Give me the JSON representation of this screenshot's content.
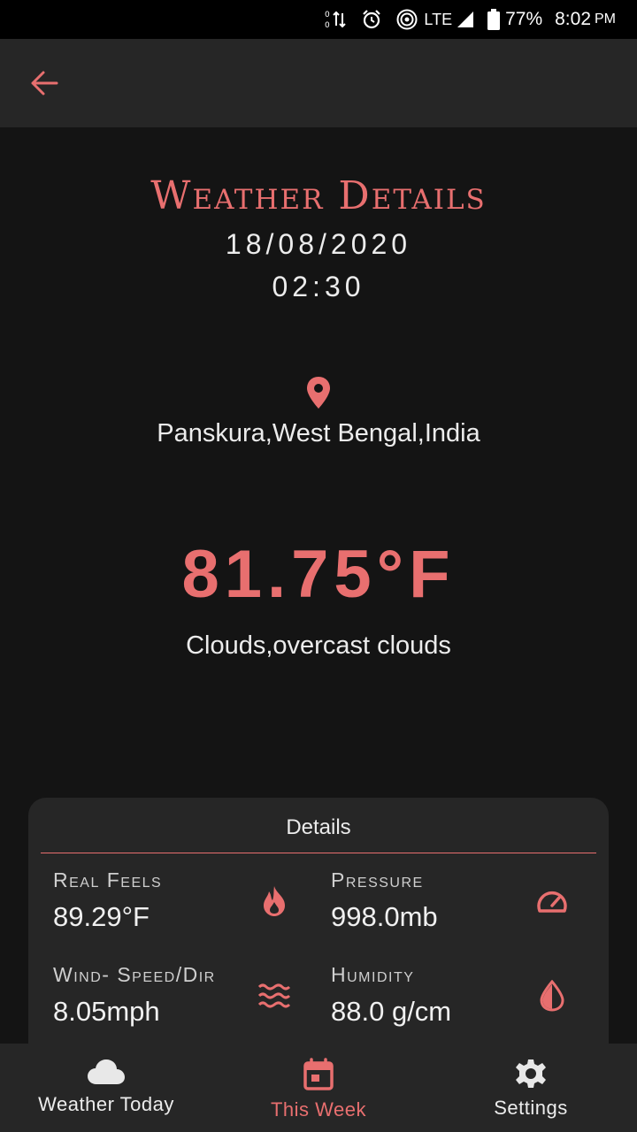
{
  "status_bar": {
    "battery": "77%",
    "time": "8:02",
    "ampm": "PM",
    "network": "LTE"
  },
  "header": {
    "title": "Weather Details",
    "date": "18/08/2020",
    "time": "02:30"
  },
  "location": "Panskura,West Bengal,India",
  "temperature": "81.75°F",
  "description": "Clouds,overcast clouds",
  "details": {
    "title": "Details",
    "real_feels": {
      "label": "Real Feels",
      "value": "89.29°F"
    },
    "pressure": {
      "label": "Pressure",
      "value": "998.0mb"
    },
    "wind": {
      "label": "Wind- Speed/Dir",
      "value": "8.05mph"
    },
    "humidity": {
      "label": "Humidity",
      "value": "88.0 g/cm"
    }
  },
  "bottom_nav": [
    {
      "label": "Weather Today",
      "icon": "cloud-icon"
    },
    {
      "label": "This Week",
      "icon": "calendar-icon"
    },
    {
      "label": "Settings",
      "icon": "gear-icon"
    }
  ],
  "colors": {
    "accent": "#e86f6f",
    "background": "#141414",
    "surface": "#262626"
  }
}
